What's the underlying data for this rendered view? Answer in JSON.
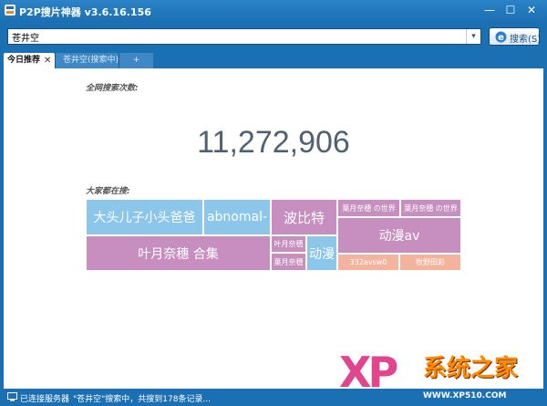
{
  "window": {
    "title": "P2P搜片神器 v3.6.16.156",
    "minimize": "—",
    "maximize": "☐",
    "close": "✕"
  },
  "search": {
    "value": "苍井空",
    "button_label": "搜索(S)"
  },
  "tabs": [
    {
      "label": "今日推荐",
      "close": "✕"
    },
    {
      "label": "苍井空(搜索中)"
    },
    {
      "label": "+"
    }
  ],
  "stats": {
    "total_label": "全网搜索次数:",
    "total_count": "11,272,906",
    "trending_label": "大家都在搜:"
  },
  "colors": {
    "blue": "#8cc6ea",
    "purple": "#c68fbf",
    "peach": "#f3b39d",
    "chrome": "#1b6fb3"
  },
  "trending": [
    {
      "text": "大头儿子小头爸爸",
      "color": "blue"
    },
    {
      "text": "abnomal-",
      "color": "blue"
    },
    {
      "text": "波比特",
      "color": "purple"
    },
    {
      "text": "葉月奈穗 の世界",
      "color": "purple"
    },
    {
      "text": "葉月奈穗 の世界",
      "color": "purple"
    },
    {
      "text": "叶月奈穗 合集",
      "color": "purple"
    },
    {
      "text": "叶月奈穗",
      "color": "purple"
    },
    {
      "text": "葉月奈穗",
      "color": "purple"
    },
    {
      "text": "动漫",
      "color": "blue"
    },
    {
      "text": "动漫av",
      "color": "purple"
    },
    {
      "text": "332avsw0",
      "color": "peach"
    },
    {
      "text": "牧野田彩",
      "color": "peach"
    }
  ],
  "status": {
    "connection": "已连接服务器",
    "message": "\"苍井空\"搜索中，共搜到178条记录..."
  },
  "watermark": {
    "xp": "XP",
    "site_name": "系统之家",
    "url": "WWW.XP510.COM"
  }
}
